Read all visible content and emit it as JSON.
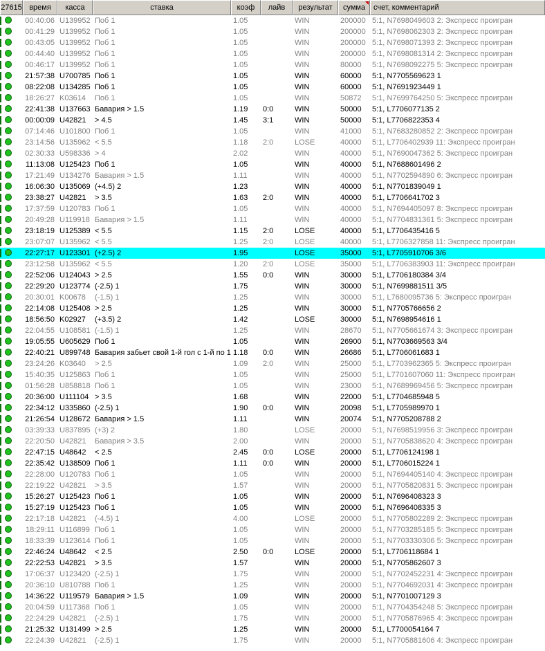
{
  "headers": [
    "27615",
    "время",
    "касса",
    "ставка",
    "коэф",
    "лайв",
    "результат",
    "сумма",
    "счет, комментарий"
  ],
  "rows": [
    {
      "t": "00:40:06",
      "k": "U139952",
      "b": "Поб 1",
      "o": "1.05",
      "l": "",
      "r": "WIN",
      "s": "200000",
      "m": "5:1, N7698049603 2: Экспресс проигран",
      "dim": true
    },
    {
      "t": "00:41:29",
      "k": "U139952",
      "b": "Поб 1",
      "o": "1.05",
      "l": "",
      "r": "WIN",
      "s": "200000",
      "m": "5:1, N7698062303 2: Экспресс проигран",
      "dim": true
    },
    {
      "t": "00:43:05",
      "k": "U139952",
      "b": "Поб 1",
      "o": "1.05",
      "l": "",
      "r": "WIN",
      "s": "200000",
      "m": "5:1, N7698071393 2: Экспресс проигран",
      "dim": true
    },
    {
      "t": "00:44:40",
      "k": "U139952",
      "b": "Поб 1",
      "o": "1.05",
      "l": "",
      "r": "WIN",
      "s": "200000",
      "m": "5:1, N7698081314 2: Экспресс проигран",
      "dim": true
    },
    {
      "t": "00:46:17",
      "k": "U139952",
      "b": "Поб 1",
      "o": "1.05",
      "l": "",
      "r": "WIN",
      "s": "80000",
      "m": "5:1, N7698092275 5: Экспресс проигран",
      "dim": true
    },
    {
      "t": "21:57:38",
      "k": "U700785",
      "b": "Поб 1",
      "o": "1.05",
      "l": "",
      "r": "WIN",
      "s": "60000",
      "m": "5:1, N7705569623 1",
      "dim": false
    },
    {
      "t": "08:22:08",
      "k": "U134285",
      "b": "Поб 1",
      "o": "1.05",
      "l": "",
      "r": "WIN",
      "s": "60000",
      "m": "5:1, N7691923449 1",
      "dim": false
    },
    {
      "t": "18:26:27",
      "k": "K03614",
      "b": "Поб 1",
      "o": "1.05",
      "l": "",
      "r": "WIN",
      "s": "50872",
      "m": "5:1, N7699764250 5: Экспресс проигран",
      "dim": true
    },
    {
      "t": "22:41:38",
      "k": "U137663",
      "b": "Бавария > 1.5",
      "o": "1.19",
      "l": "0:0",
      "r": "WIN",
      "s": "50000",
      "m": "5:1, L7706077135 2",
      "dim": false
    },
    {
      "t": "00:00:09",
      "k": "U42821",
      "b": "> 4.5",
      "o": "1.45",
      "l": "3:1",
      "r": "WIN",
      "s": "50000",
      "m": "5:1, L7706822353 4",
      "dim": false
    },
    {
      "t": "07:14:46",
      "k": "U101800",
      "b": "Поб 1",
      "o": "1.05",
      "l": "",
      "r": "WIN",
      "s": "41000",
      "m": "5:1, N7683280852 2: Экспресс проигран",
      "dim": true
    },
    {
      "t": "23:14:56",
      "k": "U135962",
      "b": "< 5.5",
      "o": "1.18",
      "l": "2:0",
      "r": "LOSE",
      "s": "40000",
      "m": "5:1, L7706402939 11: Экспресс проигран",
      "dim": true
    },
    {
      "t": "02:30:33",
      "k": "U598336",
      "b": "> 4",
      "o": "2.02",
      "l": "",
      "r": "WIN",
      "s": "40000",
      "m": "5:1, N7690047362 5: Экспресс проигран",
      "dim": true
    },
    {
      "t": "11:13:08",
      "k": "U125423",
      "b": "Поб 1",
      "o": "1.05",
      "l": "",
      "r": "WIN",
      "s": "40000",
      "m": "5:1, N7688601496 2",
      "dim": false
    },
    {
      "t": "17:21:49",
      "k": "U134276",
      "b": "Бавария > 1.5",
      "o": "1.11",
      "l": "",
      "r": "WIN",
      "s": "40000",
      "m": "5:1, N7702594890 6: Экспресс проигран",
      "dim": true
    },
    {
      "t": "16:06:30",
      "k": "U135069",
      "b": "(+4.5) 2",
      "o": "1.23",
      "l": "",
      "r": "WIN",
      "s": "40000",
      "m": "5:1, N7701839049 1",
      "dim": false
    },
    {
      "t": "23:38:27",
      "k": "U42821",
      "b": "> 3.5",
      "o": "1.63",
      "l": "2:0",
      "r": "WIN",
      "s": "40000",
      "m": "5:1, L7706641702 3",
      "dim": false
    },
    {
      "t": "17:37:59",
      "k": "U120783",
      "b": "Поб 1",
      "o": "1.05",
      "l": "",
      "r": "WIN",
      "s": "40000",
      "m": "5:1, N7694405097 8: Экспресс проигран",
      "dim": true
    },
    {
      "t": "20:49:28",
      "k": "U119918",
      "b": "Бавария > 1.5",
      "o": "1.11",
      "l": "",
      "r": "WIN",
      "s": "40000",
      "m": "5:1, N7704831361 5: Экспресс проигран",
      "dim": true
    },
    {
      "t": "23:18:19",
      "k": "U125389",
      "b": "< 5.5",
      "o": "1.15",
      "l": "2:0",
      "r": "LOSE",
      "s": "40000",
      "m": "5:1, L7706435416 5",
      "dim": false
    },
    {
      "t": "23:07:07",
      "k": "U135962",
      "b": "< 5.5",
      "o": "1.25",
      "l": "2:0",
      "r": "LOSE",
      "s": "40000",
      "m": "5:1, L7706327858 11: Экспресс проигран",
      "dim": true
    },
    {
      "t": "22:27:17",
      "k": "U123301",
      "b": "(+2.5) 2",
      "o": "1.95",
      "l": "",
      "r": "LOSE",
      "s": "35000",
      "m": "5:1, L7705910706 3/6",
      "dim": false,
      "sel": true
    },
    {
      "t": "23:12:58",
      "k": "U135962",
      "b": "< 5.5",
      "o": "1.20",
      "l": "2:0",
      "r": "LOSE",
      "s": "35000",
      "m": "5:1, L7706383903 11: Экспресс проигран",
      "dim": true
    },
    {
      "t": "22:52:06",
      "k": "U124043",
      "b": "> 2.5",
      "o": "1.55",
      "l": "0:0",
      "r": "WIN",
      "s": "30000",
      "m": "5:1, L7706180384 3/4",
      "dim": false
    },
    {
      "t": "22:29:20",
      "k": "U123774",
      "b": "(-2.5) 1",
      "o": "1.75",
      "l": "",
      "r": "WIN",
      "s": "30000",
      "m": "5:1, N7699881511 3/5",
      "dim": false
    },
    {
      "t": "20:30:01",
      "k": "K00678",
      "b": "(-1.5) 1",
      "o": "1.25",
      "l": "",
      "r": "WIN",
      "s": "30000",
      "m": "5:1, L7680095736 5: Экспресс проигран",
      "dim": true
    },
    {
      "t": "22:14:08",
      "k": "U125408",
      "b": "> 2.5",
      "o": "1.25",
      "l": "",
      "r": "WIN",
      "s": "30000",
      "m": "5:1, N7705766656 2",
      "dim": false
    },
    {
      "t": "18:56:50",
      "k": "K02927",
      "b": "(+3.5) 2",
      "o": "1.42",
      "l": "",
      "r": "LOSE",
      "s": "30000",
      "m": "5:1, N7698954616 1",
      "dim": false
    },
    {
      "t": "22:04:55",
      "k": "U108581",
      "b": "(-1.5) 1",
      "o": "1.25",
      "l": "",
      "r": "WIN",
      "s": "28670",
      "m": "5:1, N7705661674 3: Экспресс проигран",
      "dim": true
    },
    {
      "t": "19:05:55",
      "k": "U605629",
      "b": "Поб 1",
      "o": "1.05",
      "l": "",
      "r": "WIN",
      "s": "26900",
      "m": "5:1, N7703669563 3/4",
      "dim": false
    },
    {
      "t": "22:40:21",
      "k": "U899748",
      "b": "Бавария забьет свой 1-й гол с 1-й по 15-ю",
      "o": "1.18",
      "l": "0:0",
      "r": "WIN",
      "s": "26686",
      "m": "5:1, L7706061683 1",
      "dim": false
    },
    {
      "t": "23:24:26",
      "k": "K03640",
      "b": "> 2.5",
      "o": "1.09",
      "l": "2:0",
      "r": "WIN",
      "s": "25000",
      "m": "5:1, L7703962365 5: Экспресс проигран",
      "dim": true
    },
    {
      "t": "15:40:35",
      "k": "U125863",
      "b": "Поб 1",
      "o": "1.05",
      "l": "",
      "r": "WIN",
      "s": "25000",
      "m": "5:1, L7701607060 11: Экспресс проигран",
      "dim": true
    },
    {
      "t": "01:56:28",
      "k": "U858818",
      "b": "Поб 1",
      "o": "1.05",
      "l": "",
      "r": "WIN",
      "s": "23000",
      "m": "5:1, N7689969456 5: Экспресс проигран",
      "dim": true
    },
    {
      "t": "20:36:00",
      "k": "U111104",
      "b": "> 3.5",
      "o": "1.68",
      "l": "",
      "r": "WIN",
      "s": "22000",
      "m": "5:1, L7704685948 5",
      "dim": false
    },
    {
      "t": "22:34:12",
      "k": "U335860",
      "b": "(-2.5) 1",
      "o": "1.90",
      "l": "0:0",
      "r": "WIN",
      "s": "20098",
      "m": "5:1, L7705989970 1",
      "dim": false
    },
    {
      "t": "21:26:54",
      "k": "U128672",
      "b": "Бавария > 1.5",
      "o": "1.11",
      "l": "",
      "r": "WIN",
      "s": "20074",
      "m": "5:1, N7705208788 2",
      "dim": false
    },
    {
      "t": "03:39:33",
      "k": "U837895",
      "b": "(+3) 2",
      "o": "1.80",
      "l": "",
      "r": "LOSE",
      "s": "20000",
      "m": "5:1, N7698519956 3: Экспресс проигран",
      "dim": true
    },
    {
      "t": "22:20:50",
      "k": "U42821",
      "b": "Бавария > 3.5",
      "o": "2.00",
      "l": "",
      "r": "WIN",
      "s": "20000",
      "m": "5:1, N7705838620 4: Экспресс проигран",
      "dim": true
    },
    {
      "t": "22:47:15",
      "k": "U48642",
      "b": "< 2.5",
      "o": "2.45",
      "l": "0:0",
      "r": "LOSE",
      "s": "20000",
      "m": "5:1, L7706124198 1",
      "dim": false
    },
    {
      "t": "22:35:42",
      "k": "U138509",
      "b": "Поб 1",
      "o": "1.11",
      "l": "0:0",
      "r": "WIN",
      "s": "20000",
      "m": "5:1, L7706015224 1",
      "dim": false
    },
    {
      "t": "22:28:00",
      "k": "U120783",
      "b": "Поб 1",
      "o": "1.05",
      "l": "",
      "r": "WIN",
      "s": "20000",
      "m": "5:1, N7694405140 4: Экспресс проигран",
      "dim": true
    },
    {
      "t": "22:19:22",
      "k": "U42821",
      "b": "> 3.5",
      "o": "1.57",
      "l": "",
      "r": "WIN",
      "s": "20000",
      "m": "5:1, N7705820831 5: Экспресс проигран",
      "dim": true
    },
    {
      "t": "15:26:27",
      "k": "U125423",
      "b": "Поб 1",
      "o": "1.05",
      "l": "",
      "r": "WIN",
      "s": "20000",
      "m": "5:1, N7696408323 3",
      "dim": false
    },
    {
      "t": "15:27:19",
      "k": "U125423",
      "b": "Поб 1",
      "o": "1.05",
      "l": "",
      "r": "WIN",
      "s": "20000",
      "m": "5:1, N7696408335 3",
      "dim": false
    },
    {
      "t": "22:17:18",
      "k": "U42821",
      "b": "(-4.5) 1",
      "o": "4.00",
      "l": "",
      "r": "LOSE",
      "s": "20000",
      "m": "5:1, N7705802289 2: Экспресс проигран",
      "dim": true
    },
    {
      "t": "18:29:11",
      "k": "U116899",
      "b": "Поб 1",
      "o": "1.05",
      "l": "",
      "r": "WIN",
      "s": "20000",
      "m": "5:1, N7703285185 5: Экспресс проигран",
      "dim": true
    },
    {
      "t": "18:33:39",
      "k": "U123614",
      "b": "Поб 1",
      "o": "1.05",
      "l": "",
      "r": "WIN",
      "s": "20000",
      "m": "5:1, N7703330306 5: Экспресс проигран",
      "dim": true
    },
    {
      "t": "22:46:24",
      "k": "U48642",
      "b": "< 2.5",
      "o": "2.50",
      "l": "0:0",
      "r": "LOSE",
      "s": "20000",
      "m": "5:1, L7706118684 1",
      "dim": false
    },
    {
      "t": "22:22:53",
      "k": "U42821",
      "b": "> 3.5",
      "o": "1.57",
      "l": "",
      "r": "WIN",
      "s": "20000",
      "m": "5:1, N7705862607 3",
      "dim": false
    },
    {
      "t": "17:06:37",
      "k": "U123420",
      "b": "(-2.5) 1",
      "o": "1.75",
      "l": "",
      "r": "WIN",
      "s": "20000",
      "m": "5:1, N7702452231 4: Экспресс проигран",
      "dim": true
    },
    {
      "t": "20:36:10",
      "k": "U810788",
      "b": "Поб 1",
      "o": "1.25",
      "l": "",
      "r": "WIN",
      "s": "20000",
      "m": "5:1, N7704692031 4: Экспресс проигран",
      "dim": true
    },
    {
      "t": "14:36:22",
      "k": "U119579",
      "b": "Бавария > 1.5",
      "o": "1.09",
      "l": "",
      "r": "WIN",
      "s": "20000",
      "m": "5:1, N7701007129 3",
      "dim": false
    },
    {
      "t": "20:04:59",
      "k": "U117368",
      "b": "Поб 1",
      "o": "1.05",
      "l": "",
      "r": "WIN",
      "s": "20000",
      "m": "5:1, N7704354248 5: Экспресс проигран",
      "dim": true
    },
    {
      "t": "22:24:29",
      "k": "U42821",
      "b": "(-2.5) 1",
      "o": "1.75",
      "l": "",
      "r": "WIN",
      "s": "20000",
      "m": "5:1, N7705876965 4: Экспресс проигран",
      "dim": true
    },
    {
      "t": "21:25:32",
      "k": "U131499",
      "b": "> 2.5",
      "o": "1.25",
      "l": "",
      "r": "WIN",
      "s": "20000",
      "m": "5:1, L7700054164 7",
      "dim": false
    },
    {
      "t": "22:24:39",
      "k": "U42821",
      "b": "(-2.5) 1",
      "o": "1.75",
      "l": "",
      "r": "WIN",
      "s": "20000",
      "m": "5:1, N7705881606 4: Экспресс проигран",
      "dim": true
    }
  ]
}
